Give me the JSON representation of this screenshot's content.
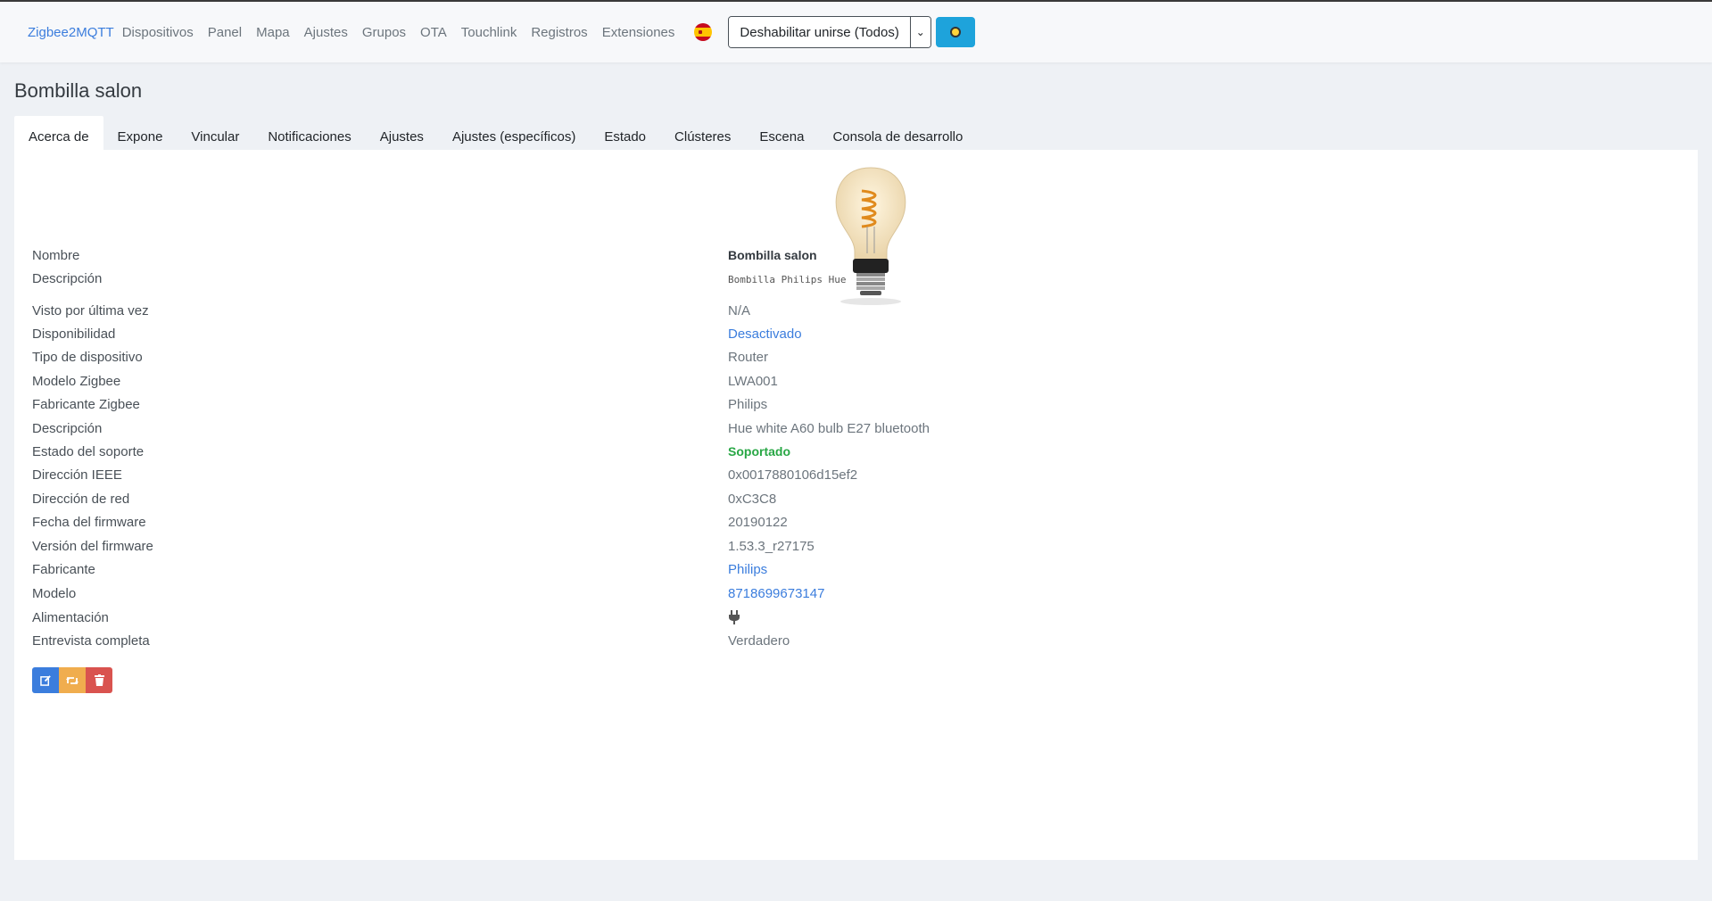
{
  "nav": {
    "brand": "Zigbee2MQTT",
    "links": [
      "Dispositivos",
      "Panel",
      "Mapa",
      "Ajustes",
      "Grupos",
      "OTA",
      "Touchlink",
      "Registros",
      "Extensiones"
    ],
    "language_icon": "spain-flag-icon",
    "join_button": "Deshabilitar unirse (Todos)",
    "theme_icon": "sun-icon"
  },
  "page": {
    "title": "Bombilla salon"
  },
  "tabs": [
    "Acerca de",
    "Expone",
    "Vincular",
    "Notificaciones",
    "Ajustes",
    "Ajustes (específicos)",
    "Estado",
    "Clústeres",
    "Escena",
    "Consola de desarrollo"
  ],
  "details": [
    {
      "label": "Nombre",
      "value": "Bombilla salon"
    },
    {
      "label": "Descripción",
      "value": "Bombilla Philips Hue"
    },
    {
      "label": "Visto por última vez",
      "value": "N/A"
    },
    {
      "label": "Disponibilidad",
      "value": "Desactivado"
    },
    {
      "label": "Tipo de dispositivo",
      "value": "Router"
    },
    {
      "label": "Modelo Zigbee",
      "value": "LWA001"
    },
    {
      "label": "Fabricante Zigbee",
      "value": "Philips"
    },
    {
      "label": "Descripción",
      "value": "Hue white A60 bulb E27 bluetooth"
    },
    {
      "label": "Estado del soporte",
      "value": "Soportado"
    },
    {
      "label": "Dirección IEEE",
      "value": "0x0017880106d15ef2"
    },
    {
      "label": "Dirección de red",
      "value": "0xC3C8"
    },
    {
      "label": "Fecha del firmware",
      "value": "20190122"
    },
    {
      "label": "Versión del firmware",
      "value": "1.53.3_r27175"
    },
    {
      "label": "Fabricante",
      "value": "Philips"
    },
    {
      "label": "Modelo",
      "value": "8718699673147"
    },
    {
      "label": "Alimentación",
      "value": "plug-icon"
    },
    {
      "label": "Entrevista completa",
      "value": "Verdadero"
    }
  ],
  "colors": {
    "link": "#3b7ddd",
    "success": "#28a745",
    "theme_button": "#1ea3db",
    "edit": "#3b7ddd",
    "reconfigure": "#f0ad4e",
    "delete": "#d9534f"
  }
}
